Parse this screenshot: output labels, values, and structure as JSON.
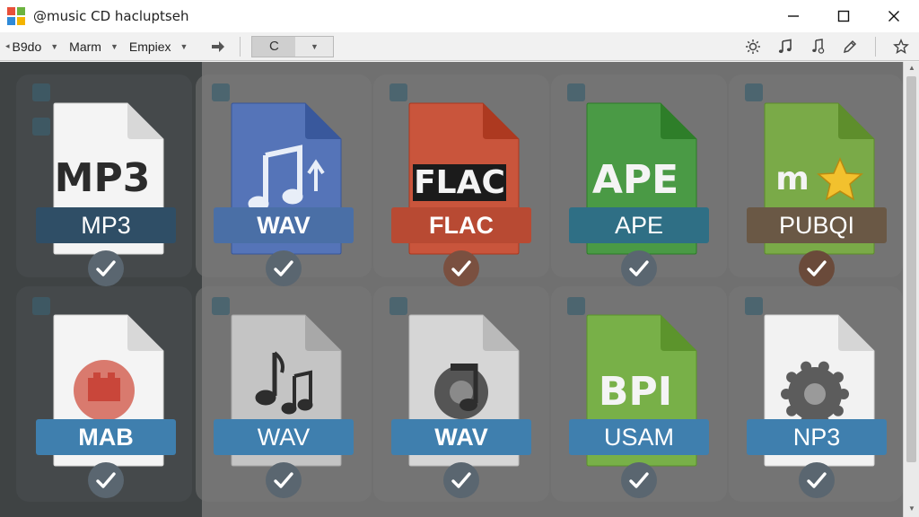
{
  "window": {
    "title": "@music CD hacluptseh",
    "controls": {
      "minimize": "–",
      "maximize": "□",
      "close": "✕"
    }
  },
  "toolbar": {
    "menus": [
      {
        "label": "B9do",
        "has_dropdown": true
      },
      {
        "label": "Marm",
        "has_dropdown": true
      },
      {
        "label": "Empiex",
        "has_dropdown": true
      }
    ],
    "combo_value": "C",
    "right_icons": [
      "sun-settings-icon",
      "music-note-icon",
      "music-settings-icon",
      "pen-icon",
      "star-icon"
    ]
  },
  "files": [
    {
      "row": 1,
      "big_text": "MP3",
      "label": "MP3",
      "doc_color": "#f4f4f4",
      "label_color": "#2f4e66",
      "check_color": "#5a6670",
      "label_bold": false,
      "art": "text"
    },
    {
      "row": 1,
      "big_text": "",
      "label": "WAV",
      "doc_color": "#5574b8",
      "label_color": "#4a6fa6",
      "check_color": "#5a6670",
      "label_bold": true,
      "art": "music-up"
    },
    {
      "row": 1,
      "big_text": "FLAC",
      "label": "FLAC",
      "doc_color": "#c9553c",
      "label_color": "#b84a33",
      "check_color": "#7a5040",
      "label_bold": true,
      "art": "text-boxed"
    },
    {
      "row": 1,
      "big_text": "APE",
      "label": "APE",
      "doc_color": "#4a9a45",
      "label_color": "#2f6f85",
      "check_color": "#5a6670",
      "label_bold": false,
      "art": "text"
    },
    {
      "row": 1,
      "big_text": "m",
      "label": "PUBQI",
      "doc_color": "#7aaa48",
      "label_color": "#6a5845",
      "check_color": "#6a4a3a",
      "label_bold": false,
      "art": "star"
    },
    {
      "row": 2,
      "big_text": "",
      "label": "MAB",
      "doc_color": "#f4f4f4",
      "label_color": "#3f7fae",
      "check_color": "#5a6670",
      "label_bold": true,
      "art": "red-disc"
    },
    {
      "row": 2,
      "big_text": "",
      "label": "WAV",
      "doc_color": "#c4c4c4",
      "label_color": "#3f7fae",
      "check_color": "#5a6670",
      "label_bold": false,
      "art": "music-notes"
    },
    {
      "row": 2,
      "big_text": "",
      "label": "WAV",
      "doc_color": "#d6d6d6",
      "label_color": "#3f7fae",
      "check_color": "#5a6670",
      "label_bold": true,
      "art": "gear-note"
    },
    {
      "row": 2,
      "big_text": "BPI",
      "label": "USAM",
      "doc_color": "#78b048",
      "label_color": "#3f7fae",
      "check_color": "#5a6670",
      "label_bold": false,
      "art": "text"
    },
    {
      "row": 2,
      "big_text": "",
      "label": "NP3",
      "doc_color": "#f2f2f2",
      "label_color": "#3f7fae",
      "check_color": "#5a6670",
      "label_bold": false,
      "art": "gear"
    }
  ]
}
